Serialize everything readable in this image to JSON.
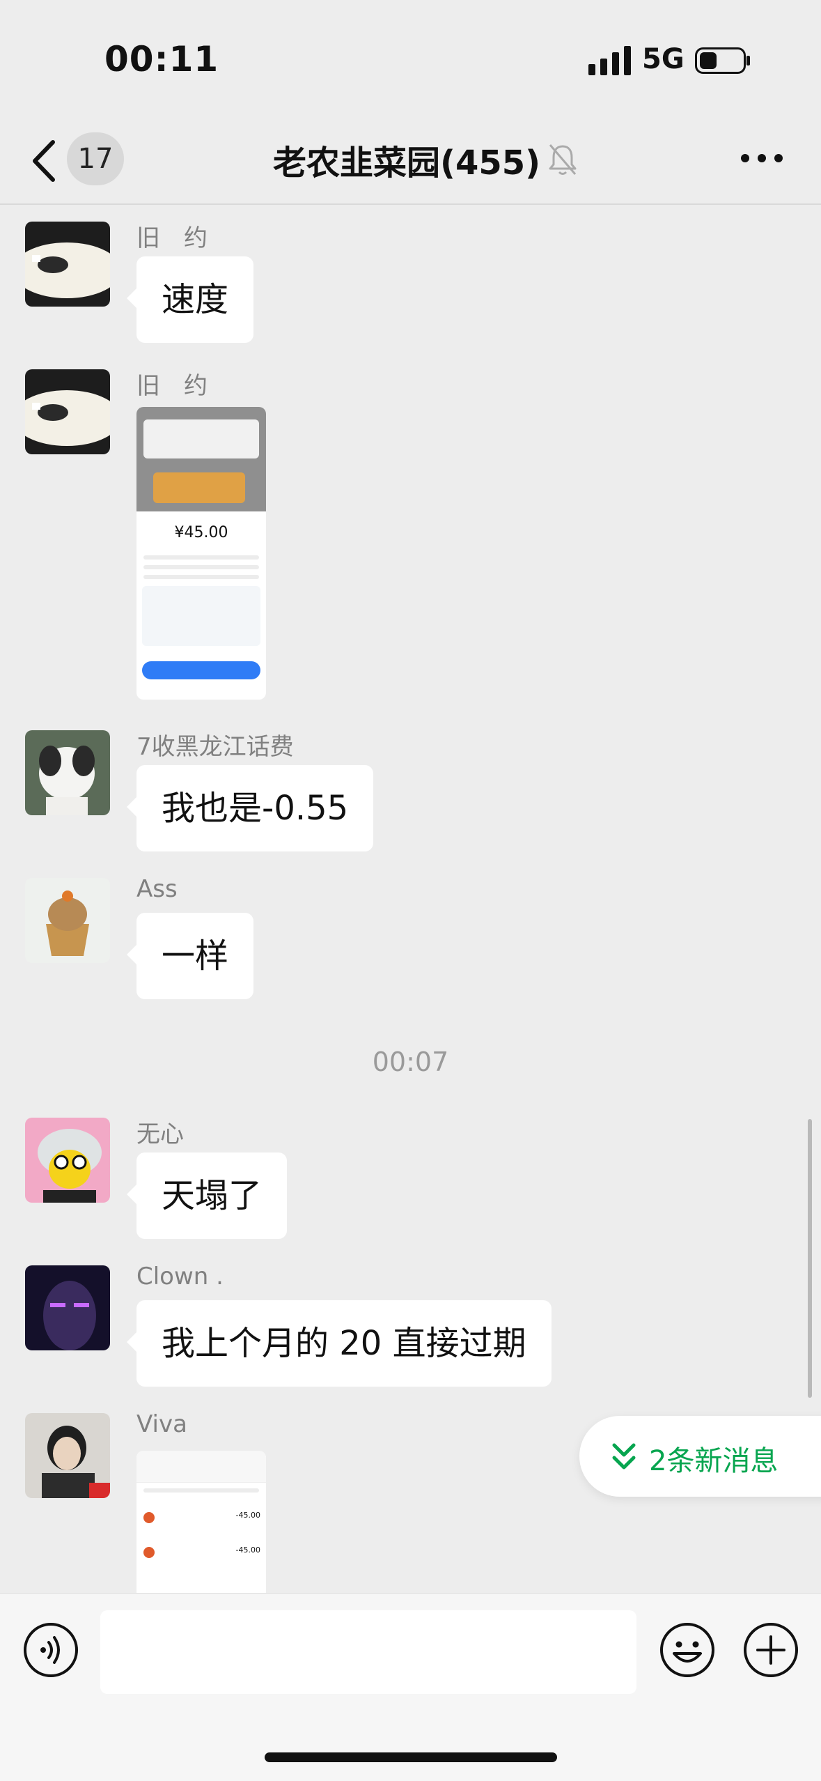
{
  "status_bar": {
    "time": "00:11",
    "network": "5G"
  },
  "header": {
    "unread_count": "17",
    "title": "老农韭菜园(455)"
  },
  "messages": [
    {
      "sender": "旧　约",
      "type": "text",
      "text": "速度"
    },
    {
      "sender": "旧　约",
      "type": "image",
      "image_price": "¥45.00"
    },
    {
      "sender": "7收黑龙江话费",
      "type": "text",
      "text": "我也是-0.55"
    },
    {
      "sender": "Ass",
      "type": "text",
      "text": "一样"
    },
    {
      "sender": "无心",
      "type": "text",
      "text": "天塌了"
    },
    {
      "sender": "Clown .",
      "type": "text",
      "text": "我上个月的 20 直接过期"
    },
    {
      "sender": "Viva",
      "type": "image",
      "image_amount_1": "-45.00",
      "image_amount_2": "-45.00"
    }
  ],
  "timestamp": "00:07",
  "new_messages": {
    "label": "2条新消息"
  },
  "input": {
    "value": "",
    "placeholder": ""
  },
  "colors": {
    "background": "#ededed",
    "bubble": "#ffffff",
    "accent_green": "#07a54f",
    "pay_blue": "#2f7cf6"
  }
}
